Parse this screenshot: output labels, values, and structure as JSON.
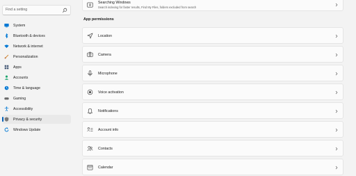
{
  "search": {
    "placeholder": "Find a setting"
  },
  "sidebar": {
    "items": [
      {
        "label": "System",
        "icon": "monitor-icon",
        "color": "#0078d4"
      },
      {
        "label": "Bluetooth & devices",
        "icon": "bluetooth-icon",
        "color": "#0078d4"
      },
      {
        "label": "Network & internet",
        "icon": "wifi-icon",
        "color": "#0078d4"
      },
      {
        "label": "Personalization",
        "icon": "brush-icon",
        "color": "#d28a3a"
      },
      {
        "label": "Apps",
        "icon": "apps-icon",
        "color": "#4a5e7a"
      },
      {
        "label": "Accounts",
        "icon": "person-icon",
        "color": "#1aa36b"
      },
      {
        "label": "Time & language",
        "icon": "globe-clock-icon",
        "color": "#0078d4"
      },
      {
        "label": "Gaming",
        "icon": "gamepad-icon",
        "color": "#6b6b6b"
      },
      {
        "label": "Accessibility",
        "icon": "accessibility-icon",
        "color": "#0078d4"
      },
      {
        "label": "Privacy & security",
        "icon": "shield-icon",
        "color": "#7a7a7a",
        "selected": true
      },
      {
        "label": "Windows Update",
        "icon": "refresh-icon",
        "color": "#0078d4"
      }
    ]
  },
  "main": {
    "top_card": {
      "label": "Searching Windows",
      "sub": "Search indexing for faster results, Find My Files, folders excluded from search",
      "icon": "search-windows-icon"
    },
    "section_title": "App permissions",
    "permissions": [
      {
        "label": "Location",
        "icon": "location-icon"
      },
      {
        "label": "Camera",
        "icon": "camera-icon"
      },
      {
        "label": "Microphone",
        "icon": "microphone-icon"
      },
      {
        "label": "Voice activation",
        "icon": "voice-activation-icon"
      },
      {
        "label": "Notifications",
        "icon": "bell-icon"
      },
      {
        "label": "Account info",
        "icon": "account-info-icon"
      },
      {
        "label": "Contacts",
        "icon": "contacts-icon"
      },
      {
        "label": "Calendar",
        "icon": "calendar-icon"
      }
    ]
  },
  "accent_color": "#005fb8"
}
